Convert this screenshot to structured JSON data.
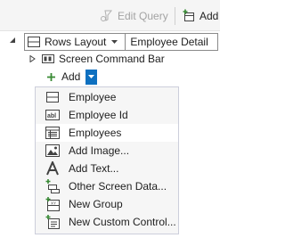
{
  "toolbar": {
    "edit_query_label": "Edit Query",
    "add_label": "Add"
  },
  "tree": {
    "root_layout": "Rows Layout",
    "root_entity": "Employee Detail",
    "command_bar": "Screen Command Bar",
    "add_label": "Add"
  },
  "menu": {
    "items": [
      {
        "label": "Employee",
        "icon": "rows-layout-icon"
      },
      {
        "label": "Employee Id",
        "icon": "text-field-icon"
      },
      {
        "label": "Employees",
        "icon": "collection-icon",
        "highlighted": true
      },
      {
        "label": "Add Image...",
        "icon": "image-icon"
      },
      {
        "label": "Add Text...",
        "icon": "text-a-icon"
      },
      {
        "label": "Other Screen Data...",
        "icon": "screen-data-icon"
      },
      {
        "label": "New Group",
        "icon": "new-group-icon"
      },
      {
        "label": "New Custom Control...",
        "icon": "custom-control-icon"
      }
    ]
  },
  "colors": {
    "accent": "#0e70c0",
    "add_green": "#388a34",
    "disabled_text": "#a3a3a3"
  }
}
